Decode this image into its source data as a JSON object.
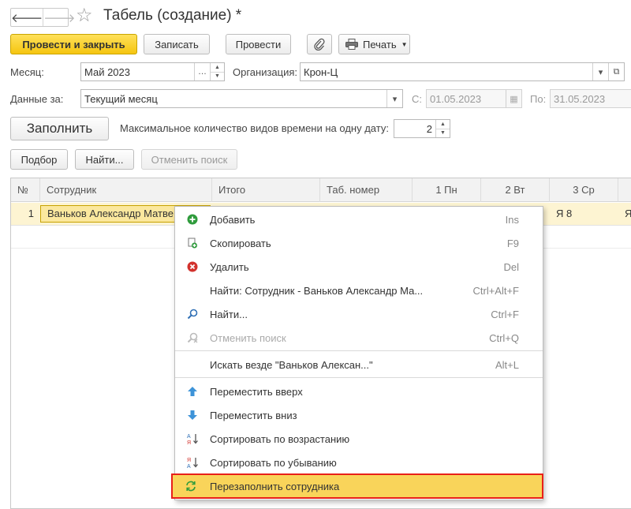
{
  "window": {
    "title": "Табель (создание) *",
    "back_glyph": "🡐",
    "forward_glyph": "🡒",
    "favorite_glyph": "☆"
  },
  "toolbar": {
    "post_close_label": "Провести и закрыть",
    "save_label": "Записать",
    "post_label": "Провести",
    "print_label": "Печать"
  },
  "form": {
    "month_label": "Месяц:",
    "month_value": "Май 2023",
    "org_label": "Организация:",
    "org_value": "Крон-Ц",
    "data_for_label": "Данные за:",
    "data_for_value": "Текущий месяц",
    "from_label": "С:",
    "from_value": "01.05.2023",
    "to_label": "По:",
    "to_value": "31.05.2023",
    "fill_label": "Заполнить",
    "max_types_label": "Максимальное количество видов времени на одну дату:",
    "max_types_value": "2"
  },
  "table_toolbar": {
    "pick_label": "Подбор",
    "find_label": "Найти...",
    "cancel_search_label": "Отменить поиск"
  },
  "table": {
    "columns": [
      "№",
      "Сотрудник",
      "Итого",
      "Таб. номер",
      "1 Пн",
      "2 Вт",
      "3 Ср"
    ],
    "rows": [
      {
        "num": "1",
        "employee": "Ваньков Александр Матве",
        "day3": "Я 8",
        "day4": "Я"
      }
    ]
  },
  "context_menu": {
    "items": [
      {
        "label": "Добавить",
        "shortcut": "Ins",
        "icon": "add-icon"
      },
      {
        "label": "Скопировать",
        "shortcut": "F9",
        "icon": "copy-icon"
      },
      {
        "label": "Удалить",
        "shortcut": "Del",
        "icon": "delete-icon"
      },
      {
        "label": "Найти: Сотрудник - Ваньков Александр Ма...",
        "shortcut": "Ctrl+Alt+F",
        "icon": ""
      },
      {
        "label": "Найти...",
        "shortcut": "Ctrl+F",
        "icon": "search-icon"
      },
      {
        "label": "Отменить поиск",
        "shortcut": "Ctrl+Q",
        "icon": "cancel-search-icon"
      },
      {
        "label": "Искать везде \"Ваньков Алексан...\"",
        "shortcut": "Alt+L",
        "icon": ""
      },
      {
        "label": "Переместить вверх",
        "shortcut": "",
        "icon": "arrow-up-icon"
      },
      {
        "label": "Переместить вниз",
        "shortcut": "",
        "icon": "arrow-down-icon"
      },
      {
        "label": "Сортировать по возрастанию",
        "shortcut": "",
        "icon": "sort-asc-icon"
      },
      {
        "label": "Сортировать по убыванию",
        "shortcut": "",
        "icon": "sort-desc-icon"
      },
      {
        "label": "Перезаполнить сотрудника",
        "shortcut": "",
        "icon": "refill-icon"
      }
    ]
  },
  "colors": {
    "primary_button": "#f5c510",
    "selected_row": "#fdf4d2",
    "menu_highlight": "#f9d45a",
    "highlight_border": "#e8201a"
  }
}
